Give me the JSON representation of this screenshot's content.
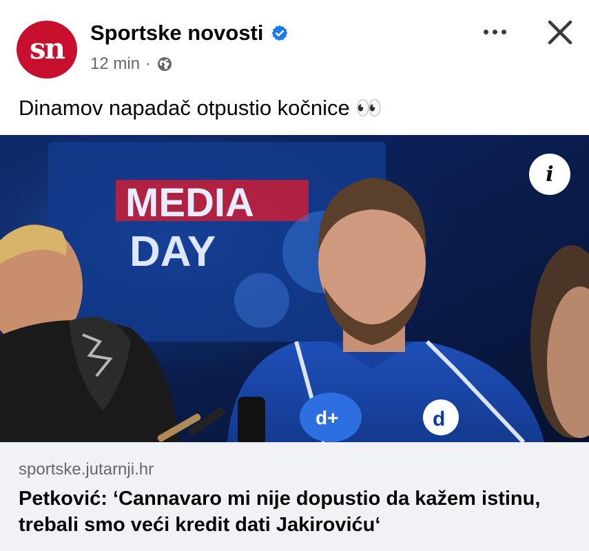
{
  "post": {
    "page_name": "Sportske novosti",
    "logo_text": "sn",
    "time": "12 min",
    "separator": "·",
    "text": "Dinamov napadač otpustio kočnice 👀"
  },
  "link": {
    "domain": "sportske.jutarnji.hr",
    "headline": "Petković: ‘Cannavaro mi nije dopustio da kažem istinu, trebali smo veći kredit dati Jakiroviću‘"
  },
  "image": {
    "screen_line1": "MEDIA",
    "screen_line2": "DAY",
    "mic_label": "d+",
    "badge_text": "d"
  },
  "icons": {
    "verified": "verified-badge-icon",
    "audience": "globe-icon",
    "more": "more-options-icon",
    "close": "close-icon",
    "info": "info-icon"
  },
  "colors": {
    "brand": "#c8102e",
    "verified": "#1877f2",
    "secondary_text": "#65676b",
    "link_bg": "#f0f2f5"
  },
  "info_label": "i"
}
